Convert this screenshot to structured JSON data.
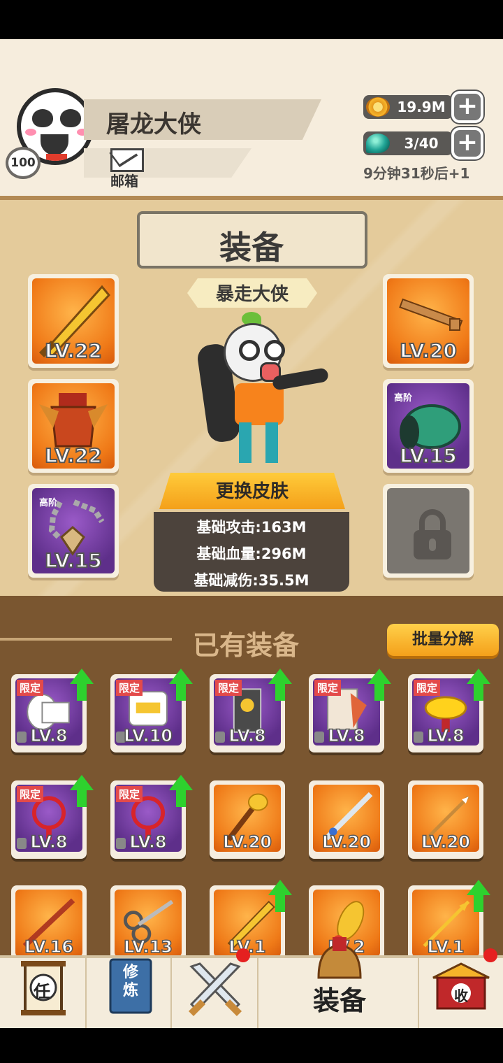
{
  "player": {
    "name": "屠龙大侠",
    "level": "100",
    "mail_label": "邮箱"
  },
  "resources": {
    "coins": {
      "value": "19.9M",
      "icon": "coin-icon"
    },
    "energy": {
      "value": "3/40",
      "icon": "gem-icon"
    },
    "timer": "9分钟31秒后+1"
  },
  "equip_panel": {
    "title": "装备",
    "character_title": "暴走大侠",
    "skin_button": "更换皮肤",
    "stats": [
      "基础攻击:163M",
      "基础血量:296M",
      "基础减伤:35.5M"
    ],
    "slots": [
      {
        "name": "sword",
        "level": "LV.22",
        "tier": ""
      },
      {
        "name": "key",
        "level": "LV.20",
        "tier": ""
      },
      {
        "name": "armor",
        "level": "LV.22",
        "tier": ""
      },
      {
        "name": "bracer",
        "level": "LV.15",
        "tier": "高阶"
      },
      {
        "name": "necklace",
        "level": "LV.15",
        "tier": "高阶"
      }
    ]
  },
  "owned": {
    "title": "已有装备",
    "batch_button": "批量分解",
    "limited_tag": "限定",
    "items": [
      {
        "level": "LV.8",
        "limited": true,
        "upgrade": true,
        "color": "purple",
        "icon": "toilet-paper-icon"
      },
      {
        "level": "LV.10",
        "limited": true,
        "upgrade": true,
        "color": "purple",
        "icon": "snack-bag-icon"
      },
      {
        "level": "LV.8",
        "limited": true,
        "upgrade": true,
        "color": "purple",
        "icon": "banner-icon"
      },
      {
        "level": "LV.8",
        "limited": true,
        "upgrade": true,
        "color": "purple",
        "icon": "book-icon"
      },
      {
        "level": "LV.8",
        "limited": true,
        "upgrade": true,
        "color": "purple",
        "icon": "gold-ingot-icon"
      },
      {
        "level": "LV.8",
        "limited": true,
        "upgrade": true,
        "color": "purple",
        "icon": "chinese-knot-icon"
      },
      {
        "level": "LV.8",
        "limited": true,
        "upgrade": true,
        "color": "purple",
        "icon": "chinese-knot-icon"
      },
      {
        "level": "LV.20",
        "limited": false,
        "upgrade": false,
        "color": "orange",
        "icon": "mace-icon"
      },
      {
        "level": "LV.20",
        "limited": false,
        "upgrade": false,
        "color": "orange",
        "icon": "sword-icon"
      },
      {
        "level": "LV.20",
        "limited": false,
        "upgrade": false,
        "color": "orange",
        "icon": "spear-icon"
      },
      {
        "level": "LV.16",
        "limited": false,
        "upgrade": false,
        "color": "orange",
        "icon": "staff-icon"
      },
      {
        "level": "LV.13",
        "limited": false,
        "upgrade": false,
        "color": "orange",
        "icon": "scissors-icon"
      },
      {
        "level": "LV.1",
        "limited": false,
        "upgrade": true,
        "color": "orange",
        "icon": "golden-sword-icon"
      },
      {
        "level": "LV.2",
        "limited": false,
        "upgrade": false,
        "color": "orange",
        "icon": "rubber-chicken-icon"
      },
      {
        "level": "LV.1",
        "limited": false,
        "upgrade": true,
        "color": "orange",
        "icon": "golden-spear-icon"
      }
    ]
  },
  "nav": {
    "task_label": "任",
    "cultivate_label": "修炼",
    "battle_icon": "crossed-swords-icon",
    "equip_label": "装备",
    "collect_label": "收"
  },
  "colors": {
    "accent": "#f4a01a",
    "panel": "#e4cb9b",
    "owned_bg": "#7a5630",
    "upgrade": "#2ed12e"
  }
}
